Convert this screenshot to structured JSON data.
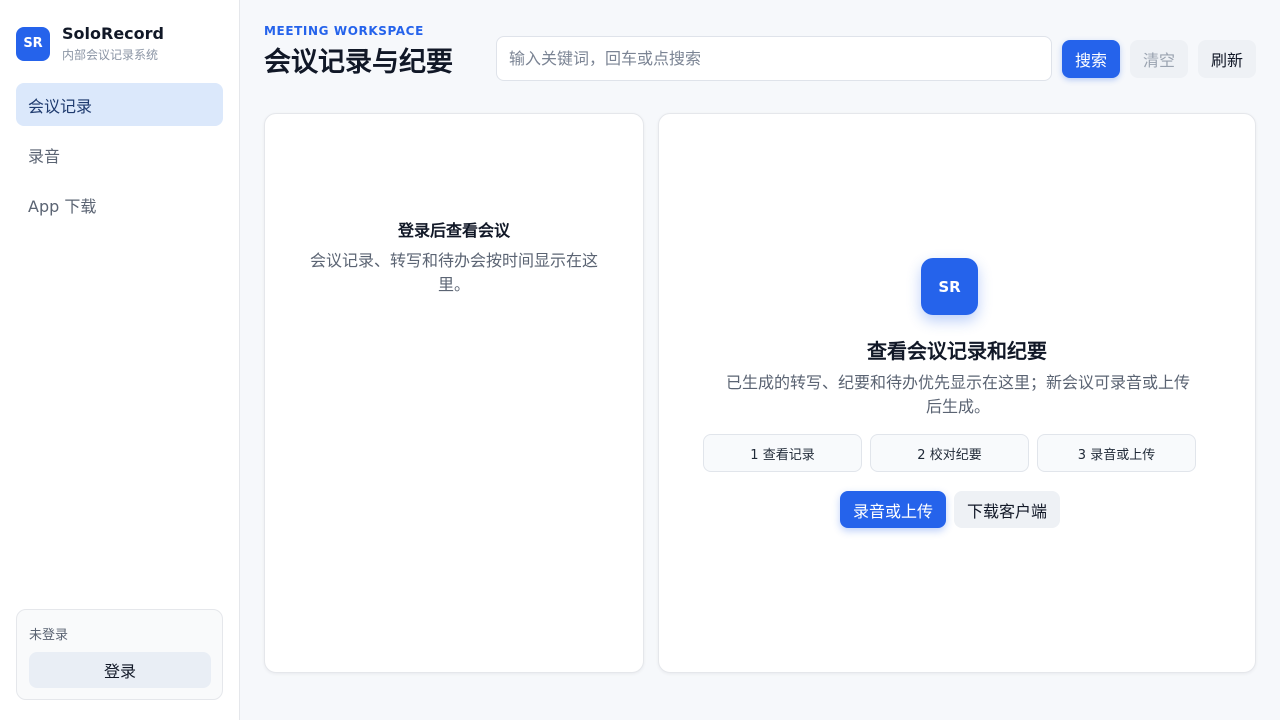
{
  "brand": {
    "logo_text": "SR",
    "name": "SoloRecord",
    "subtitle": "内部会议记录系统"
  },
  "nav": {
    "items": [
      {
        "label": "会议记录",
        "active": true
      },
      {
        "label": "录音",
        "active": false
      },
      {
        "label": "App 下载",
        "active": false
      }
    ]
  },
  "user": {
    "status": "未登录",
    "login_label": "登录"
  },
  "header": {
    "eyebrow": "MEETING WORKSPACE",
    "title": "会议记录与纪要"
  },
  "search": {
    "value": "",
    "placeholder": "输入关键词，回车或点搜索",
    "search_label": "搜索",
    "clear_label": "清空",
    "refresh_label": "刷新"
  },
  "list_panel": {
    "empty_title": "登录后查看会议",
    "empty_desc": "会议记录、转写和待办会按时间显示在这里。"
  },
  "detail_panel": {
    "logo_text": "SR",
    "title": "查看会议记录和纪要",
    "desc": "已生成的转写、纪要和待办优先显示在这里；新会议可录音或上传后生成。",
    "steps": [
      "1 查看记录",
      "2 校对纪要",
      "3 录音或上传"
    ],
    "primary_label": "录音或上传",
    "secondary_label": "下载客户端"
  },
  "colors": {
    "accent": "#2563eb",
    "nav_active_bg": "#dbe8fb",
    "page_bg": "#f6f8fb"
  }
}
